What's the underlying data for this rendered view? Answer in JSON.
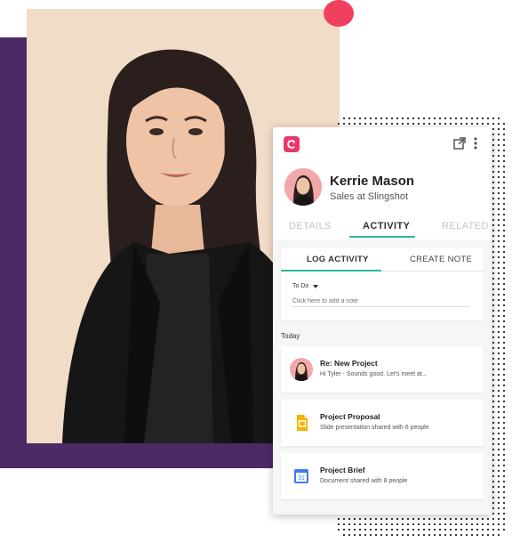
{
  "colors": {
    "brand": "#e8386a",
    "accent": "#2eb99a",
    "purple": "#4b2a66",
    "peach": "#f1dcc8",
    "dot": "#f0405e"
  },
  "header": {
    "logo_icon": "app-logo-icon",
    "external_icon": "external-link-icon",
    "more_icon": "more-vertical-icon"
  },
  "profile": {
    "name": "Kerrie Mason",
    "subtitle": "Sales at Slingshot"
  },
  "tabs": [
    {
      "label": "DETAILS",
      "active": false
    },
    {
      "label": "ACTIVITY",
      "active": true
    },
    {
      "label": "RELATED",
      "active": false
    }
  ],
  "log": {
    "subtabs": [
      {
        "label": "LOG ACTIVITY",
        "active": true
      },
      {
        "label": "CREATE NOTE",
        "active": false
      }
    ],
    "type_value": "To Do",
    "note_placeholder": "Click here to add a note"
  },
  "feed": {
    "section_label": "Today",
    "items": [
      {
        "title": "Re: New Project",
        "subtitle": "Hi Tyler - Sounds good. Let's meet at...",
        "icon": "avatar-icon"
      },
      {
        "title": "Project Proposal",
        "subtitle": "Slide presentation shared with 6 people",
        "icon": "slides-icon"
      },
      {
        "title": "Project Brief",
        "subtitle": "Document shared with 8 people",
        "icon": "calendar-doc-icon"
      }
    ]
  }
}
